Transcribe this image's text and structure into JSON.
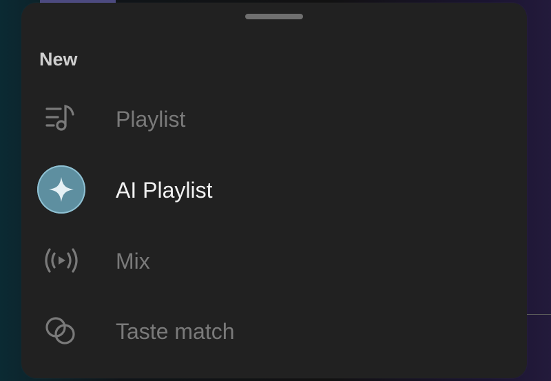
{
  "sheet": {
    "title": "New",
    "items": [
      {
        "label": "Playlist",
        "icon": "playlist-icon",
        "active": false
      },
      {
        "label": "AI Playlist",
        "icon": "sparkle-icon",
        "active": true
      },
      {
        "label": "Mix",
        "icon": "broadcast-icon",
        "active": false
      },
      {
        "label": "Taste match",
        "icon": "taste-match-icon",
        "active": false
      }
    ]
  },
  "colors": {
    "sheet_background": "#212121",
    "muted_text": "#7a7a7a",
    "active_text": "#f2f2f2",
    "ai_accent": "#5e8fa0"
  }
}
